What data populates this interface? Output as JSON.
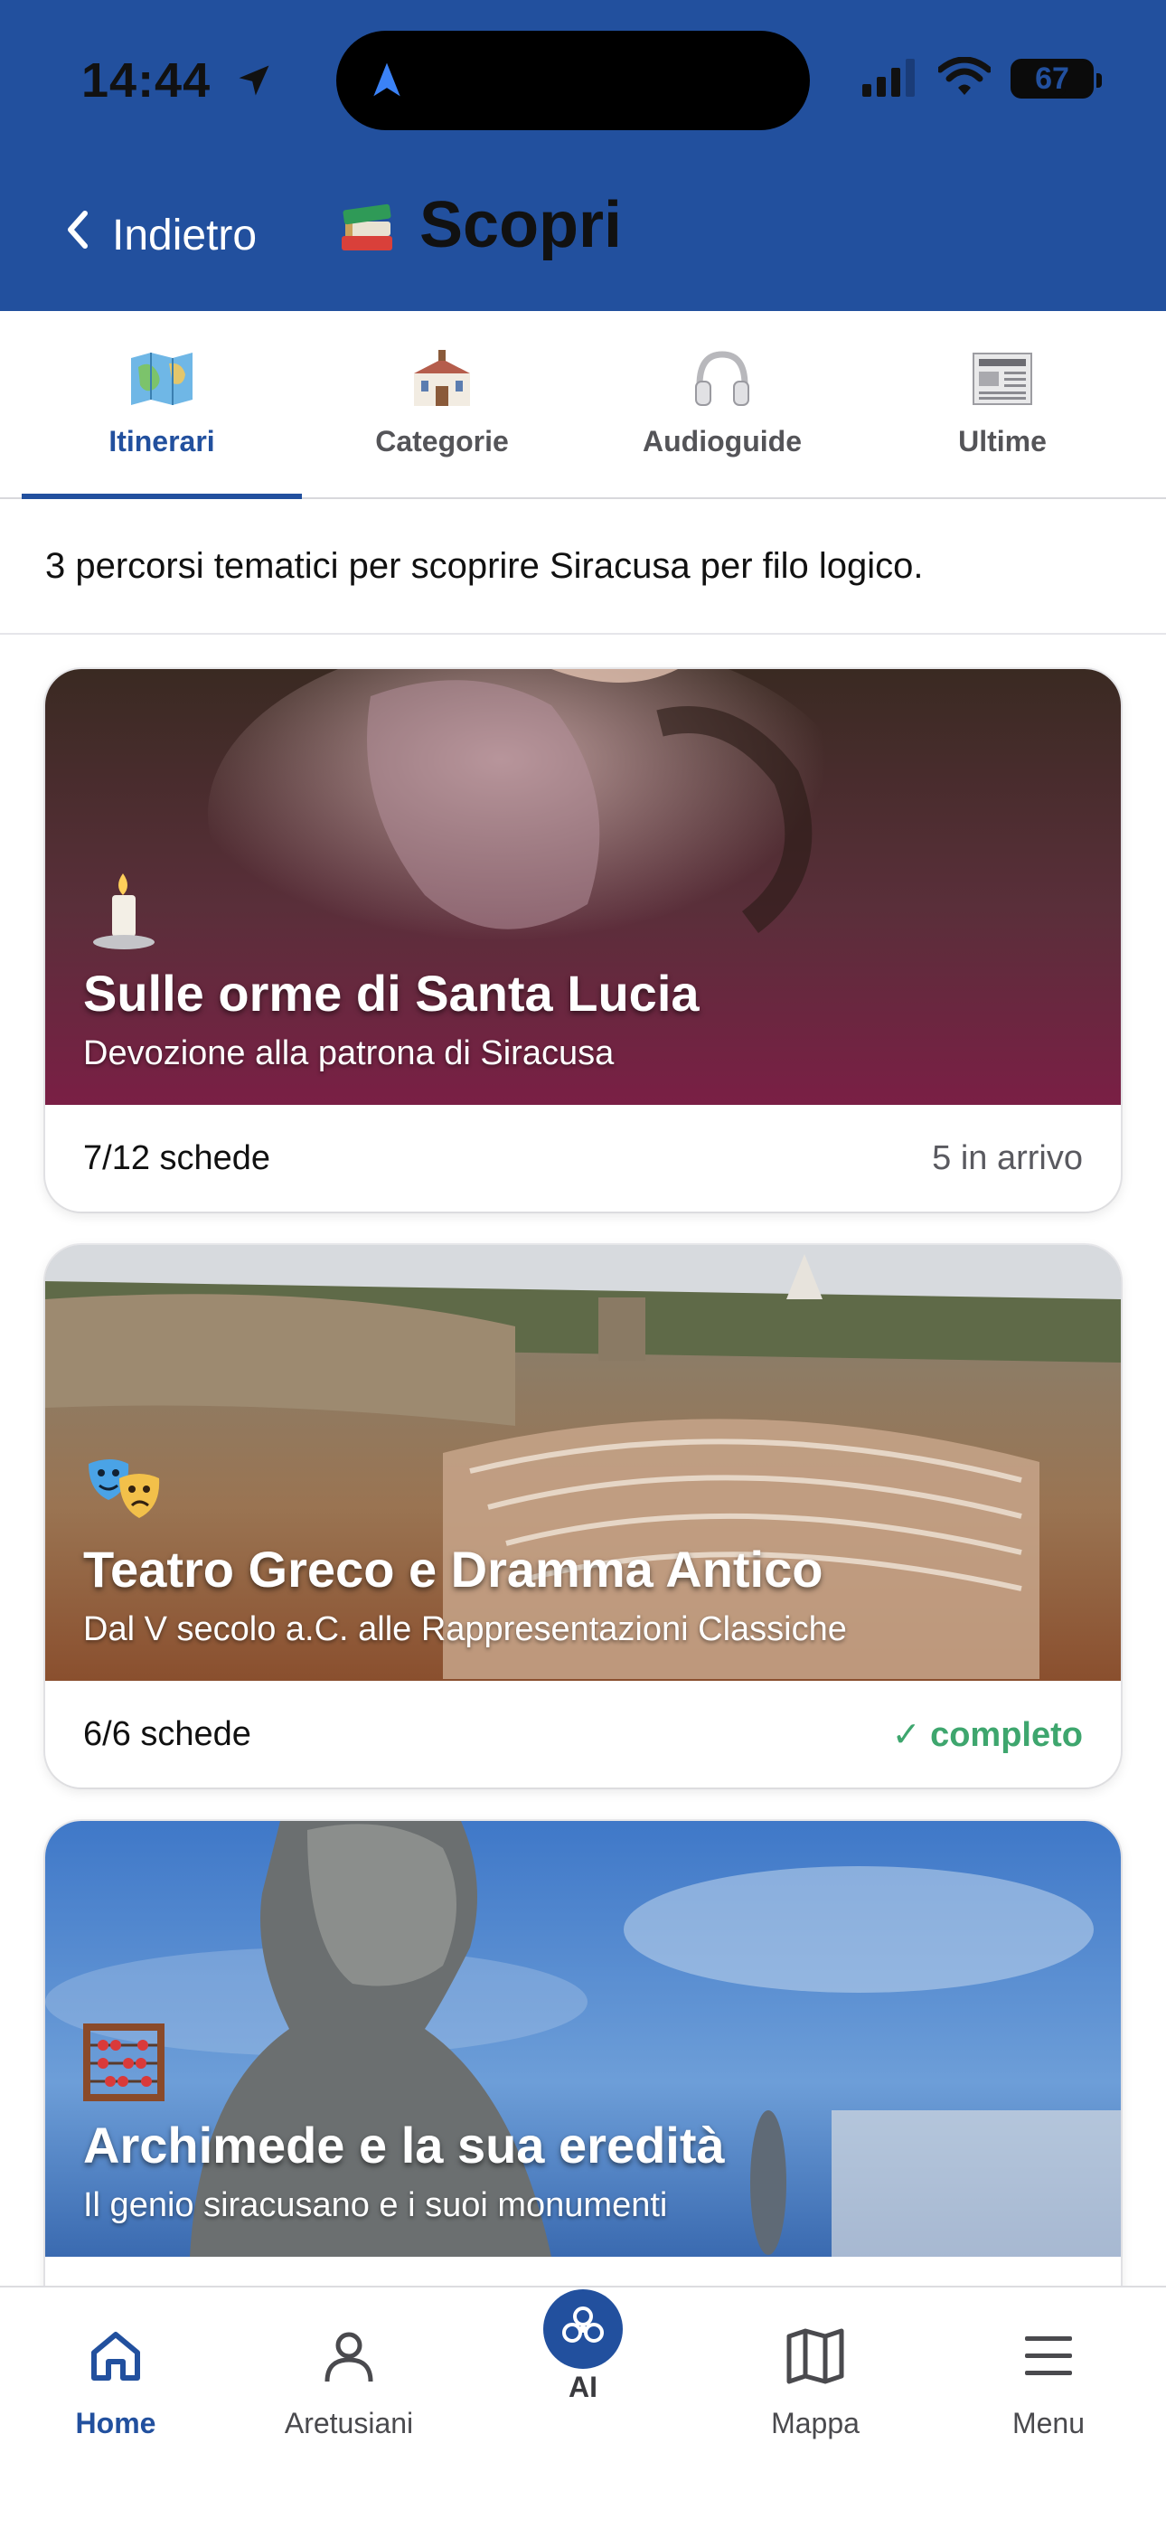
{
  "status_bar": {
    "time": "14:44",
    "battery": "67"
  },
  "header": {
    "back_label": "Indietro",
    "title": "Scopri"
  },
  "tabs": [
    {
      "label": "Itinerari",
      "icon": "map-icon",
      "active": true
    },
    {
      "label": "Categorie",
      "icon": "building-icon",
      "active": false
    },
    {
      "label": "Audioguide",
      "icon": "headphones-icon",
      "active": false
    },
    {
      "label": "Ultime",
      "icon": "newspaper-icon",
      "active": false
    }
  ],
  "intro": "3 percorsi tematici per scoprire Siracusa per filo logico.",
  "cards": [
    {
      "emoji": "candle-icon",
      "title": "Sulle orme di Santa Lucia",
      "subtitle": "Devozione alla patrona di Siracusa",
      "count": "7/12 schede",
      "status": "5 in arrivo"
    },
    {
      "emoji": "theater-masks-icon",
      "title": "Teatro Greco e Dramma Antico",
      "subtitle": "Dal V secolo a.C. alle Rappresentazioni Classiche",
      "count": "6/6 schede",
      "status": "✓ completo"
    },
    {
      "emoji": "abacus-icon",
      "title": "Archimede e la sua eredità",
      "subtitle": "Il genio siracusano e i suoi monumenti",
      "count": "",
      "status": ""
    }
  ],
  "bottom_nav": [
    {
      "label": "Home",
      "icon": "home-icon",
      "active": true
    },
    {
      "label": "Aretusiani",
      "icon": "person-icon",
      "active": false
    },
    {
      "label": "AI",
      "icon": "ai-icon",
      "active": false
    },
    {
      "label": "Mappa",
      "icon": "map-icon",
      "active": false
    },
    {
      "label": "Menu",
      "icon": "menu-icon",
      "active": false
    }
  ],
  "colors": {
    "brand": "#22509e",
    "complete": "#3ea66e"
  }
}
